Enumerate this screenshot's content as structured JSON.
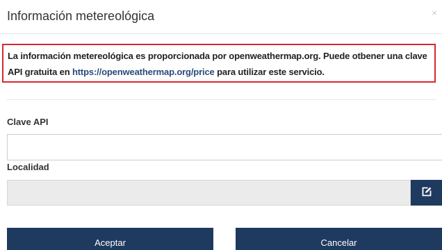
{
  "header": {
    "title": "Información metereológica",
    "close_label": "×"
  },
  "notice": {
    "text_before": "La información metereológica es proporcionada por openweathermap.org. Puede otbener una clave API gratuita en ",
    "link_text": "https://openweathermap.org/price",
    "text_after": " para utilizar este servicio."
  },
  "form": {
    "api_key_label": "Clave API",
    "api_key_value": "",
    "location_label": "Localidad",
    "location_value": ""
  },
  "buttons": {
    "accept_label": "Aceptar",
    "cancel_label": "Cancelar"
  },
  "icons": {
    "edit": "edit-icon",
    "close": "close-icon"
  },
  "colors": {
    "primary": "#1f3a5f",
    "notice_border": "#d9262f",
    "link": "#2a4a7c",
    "disabled_input": "#ebebeb"
  }
}
